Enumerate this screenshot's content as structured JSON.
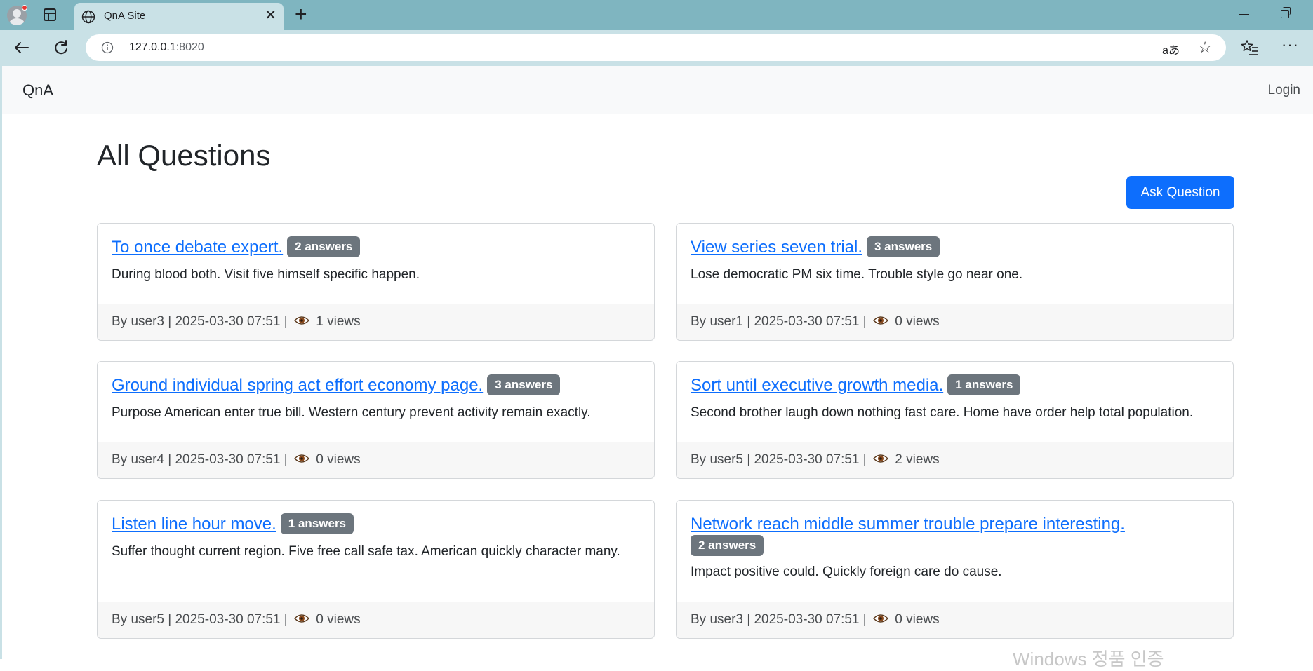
{
  "browser": {
    "tab_title": "QnA Site",
    "url_host": "127.0.0.1",
    "url_port": ":8020",
    "read_aloud": "aあ"
  },
  "navbar": {
    "brand": "QnA",
    "login": "Login"
  },
  "main": {
    "title": "All Questions",
    "ask_button": "Ask Question"
  },
  "questions": [
    {
      "title": "To once debate expert.",
      "answers": "2 answers",
      "excerpt": "During blood both. Visit five himself specific happen.",
      "meta": "By user3 | 2025-03-30 07:51 |",
      "views": "1 views"
    },
    {
      "title": "View series seven trial.",
      "answers": "3 answers",
      "excerpt": "Lose democratic PM six time. Trouble style go near one.",
      "meta": "By user1 | 2025-03-30 07:51 |",
      "views": "0 views"
    },
    {
      "title": "Ground individual spring act effort economy page.",
      "answers": "3 answers",
      "excerpt": "Purpose American enter true bill. Western century prevent activity remain exactly.",
      "meta": "By user4 | 2025-03-30 07:51 |",
      "views": "0 views"
    },
    {
      "title": "Sort until executive growth media.",
      "answers": "1 answers",
      "excerpt": "Second brother laugh down nothing fast care. Home have order help total population.",
      "meta": "By user5 | 2025-03-30 07:51 |",
      "views": "2 views"
    },
    {
      "title": "Listen line hour move.",
      "answers": "1 answers",
      "excerpt": "Suffer thought current region. Five free call safe tax. American quickly character many.",
      "meta": "By user5 | 2025-03-30 07:51 |",
      "views": "0 views"
    },
    {
      "title": "Network reach middle summer trouble prepare interesting.",
      "answers": "2 answers",
      "excerpt": "Impact positive could. Quickly foreign care do cause.",
      "meta": "By user3 | 2025-03-30 07:51 |",
      "views": "0 views"
    }
  ],
  "watermark": "Windows 정품 인증"
}
